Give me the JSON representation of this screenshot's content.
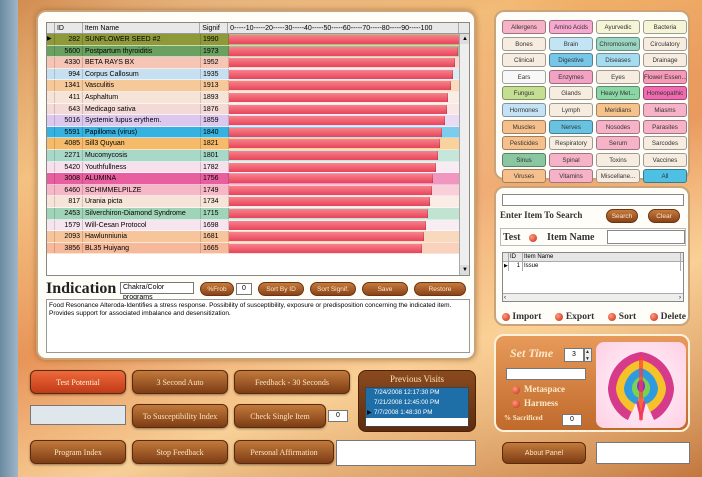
{
  "grid": {
    "headers": {
      "id": "ID",
      "name": "Item Name",
      "signif": "Signif",
      "scale": "0-----10-----20-----30-----40-----50-----60-----70-----80-----90-----100"
    },
    "rows": [
      {
        "id": "282",
        "name": "SUNFLOWER SEED #2",
        "signif": "1990",
        "value": 99.5,
        "color": "#8e9a3a"
      },
      {
        "id": "5600",
        "name": "Postpartum thyroiditis",
        "signif": "1973",
        "value": 98.6,
        "color": "#6aa060"
      },
      {
        "id": "4330",
        "name": "BETA RAYS BX",
        "signif": "1952",
        "value": 97.6,
        "color": "#f7c5b5"
      },
      {
        "id": "994",
        "name": "Corpus Callosum",
        "signif": "1935",
        "value": 96.7,
        "color": "#c6e0f2"
      },
      {
        "id": "1341",
        "name": "Vasculitis",
        "signif": "1913",
        "value": 95.6,
        "color": "#f6c99b"
      },
      {
        "id": "411",
        "name": "Asphaltum",
        "signif": "1893",
        "value": 94.6,
        "color": "#f6e4d8"
      },
      {
        "id": "643",
        "name": "Medicago sativa",
        "signif": "1876",
        "value": 93.8,
        "color": "#f4dad6"
      },
      {
        "id": "5016",
        "name": "Systemic lupus erythem.",
        "signif": "1859",
        "value": 92.9,
        "color": "#dcc8ee"
      },
      {
        "id": "5591",
        "name": "Papilloma (virus)",
        "signif": "1840",
        "value": 92.0,
        "color": "#35b2e0"
      },
      {
        "id": "4085",
        "name": "Sill3 Quyuan",
        "signif": "1821",
        "value": 91.0,
        "color": "#f6bb6a"
      },
      {
        "id": "2271",
        "name": "Mucomycosis",
        "signif": "1801",
        "value": 90.0,
        "color": "#a8d8c8"
      },
      {
        "id": "5420",
        "name": "Youthfullness",
        "signif": "1782",
        "value": 89.1,
        "color": "#f6e0ec"
      },
      {
        "id": "3008",
        "name": "ALUMINA",
        "signif": "1756",
        "value": 87.8,
        "color": "#e85fa0"
      },
      {
        "id": "6460",
        "name": "SCHIMMELPILZE",
        "signif": "1749",
        "value": 87.4,
        "color": "#f6b7c6"
      },
      {
        "id": "817",
        "name": "Urania picta",
        "signif": "1734",
        "value": 86.7,
        "color": "#f6e4d8"
      },
      {
        "id": "2453",
        "name": "Silverchiron-Diamond Syndrome",
        "signif": "1715",
        "value": 85.7,
        "color": "#a0d4b8"
      },
      {
        "id": "1579",
        "name": "Will-Cesan Protocol",
        "signif": "1698",
        "value": 84.9,
        "color": "#f6e4ee"
      },
      {
        "id": "2093",
        "name": "Hawlunniunia",
        "signif": "1681",
        "value": 84.0,
        "color": "#f6c59c"
      },
      {
        "id": "3856",
        "name": "BL35 Huiyang",
        "signif": "1665",
        "value": 83.2,
        "color": "#f6b99a"
      }
    ]
  },
  "indication": {
    "title": "Indication",
    "input_value": "Chakra/Color programs",
    "frob_label": "%Frob",
    "frob_value": "0",
    "buttons": [
      "Sort By ID",
      "Sort Signif.",
      "Save",
      "Restore"
    ],
    "description": "Food Resonance Alteroda-Identifies a stress response. Possibility of susceptibility, exposure or predisposition concerning the indicated item. Provides support for associated imbalance and desensitization."
  },
  "categories": [
    {
      "label": "Allergens",
      "color": "#f6b2c6"
    },
    {
      "label": "Amino Acids",
      "color": "#f7a8ce"
    },
    {
      "label": "Ayurvedic",
      "color": "#f6f4d6"
    },
    {
      "label": "Bacteria",
      "color": "#f6f4d6"
    },
    {
      "label": "Bones",
      "color": "#f6ece0"
    },
    {
      "label": "Brain",
      "color": "#c2e4f4"
    },
    {
      "label": "Chromosome",
      "color": "#9ad6c2"
    },
    {
      "label": "Circulatory",
      "color": "#f6ece0"
    },
    {
      "label": "Clinical",
      "color": "#f6ece0"
    },
    {
      "label": "Digestive",
      "color": "#76c6e8"
    },
    {
      "label": "Diseases",
      "color": "#a6dcf0"
    },
    {
      "label": "Drainage",
      "color": "#f6ece0"
    },
    {
      "label": "Ears",
      "color": "#f8f8f8"
    },
    {
      "label": "Enzymes",
      "color": "#f3a2c4"
    },
    {
      "label": "Eyes",
      "color": "#f6ece0"
    },
    {
      "label": "Flower Essen...",
      "color": "#f69ab8"
    },
    {
      "label": "Fungus",
      "color": "#c4de92"
    },
    {
      "label": "Glands",
      "color": "#f6ece0"
    },
    {
      "label": "Heavy Met...",
      "color": "#8ad6a4"
    },
    {
      "label": "Homeopathic",
      "color": "#f06ab0"
    },
    {
      "label": "Hormones",
      "color": "#c4e2f4"
    },
    {
      "label": "Lymph",
      "color": "#f6ece0"
    },
    {
      "label": "Meridians",
      "color": "#f6c28c"
    },
    {
      "label": "Miasms",
      "color": "#f6b2c6"
    },
    {
      "label": "Muscles",
      "color": "#f6c08c"
    },
    {
      "label": "Nerves",
      "color": "#68c2e0"
    },
    {
      "label": "Nosodes",
      "color": "#f6b2c6"
    },
    {
      "label": "Parasites",
      "color": "#f6b2c6"
    },
    {
      "label": "Pesticides",
      "color": "#f6c08c"
    },
    {
      "label": "Respiratory",
      "color": "#f6ece0"
    },
    {
      "label": "Serum",
      "color": "#f6b2c6"
    },
    {
      "label": "Sarcodes",
      "color": "#f6ece0"
    },
    {
      "label": "Sinus",
      "color": "#8ac6a0"
    },
    {
      "label": "Spinal",
      "color": "#f6b2c6"
    },
    {
      "label": "Toxins",
      "color": "#f6ece0"
    },
    {
      "label": "Vaccines",
      "color": "#f6ece0"
    },
    {
      "label": "Viruses",
      "color": "#f6c08c"
    },
    {
      "label": "Vitamins",
      "color": "#f6b2c6"
    },
    {
      "label": "Miscellane...",
      "color": "#f6ece0"
    },
    {
      "label": "All",
      "color": "#4ec0e4"
    }
  ],
  "search": {
    "label": "Enter Item To Search",
    "search_btn": "Search",
    "clear_btn": "Clear",
    "test_label": "Test",
    "item_name_label": "Item Name",
    "mini_headers": [
      "ID",
      "Item Name"
    ],
    "mini_rows": [
      {
        "id": "1",
        "name": "Issue"
      }
    ],
    "actions": [
      "Import",
      "Export",
      "Sort",
      "Delete"
    ]
  },
  "controls": {
    "test_potential": "Test Potential",
    "second_auto": "3 Second Auto",
    "feedback_30": "Feedback - 30 Seconds",
    "to_susceptibility": "To Susceptibility Index",
    "check_single": "Check Single Item",
    "check_single_value": "0",
    "program_index": "Program Index",
    "stop_feedback": "Stop Feedback",
    "personal_affirmation": "Personal Affirmation"
  },
  "previous_visits": {
    "title": "Previous Visits",
    "items": [
      {
        "label": "7/24/2008 12:17:30 PM",
        "color": "#1e6ea8"
      },
      {
        "label": "7/21/2008 12:45:00 PM",
        "color": "#1e6ea8"
      },
      {
        "label": "7/7/2008 1:48:30 PM",
        "color": "#1e6ea8"
      }
    ]
  },
  "timer": {
    "label": "Set Time",
    "value": "3",
    "metaspace": "Metaspace",
    "harmess": "Harmess",
    "sacrificed_label": "% Sacrificed",
    "sacrificed_value": "0"
  },
  "about_label": "About Panel"
}
